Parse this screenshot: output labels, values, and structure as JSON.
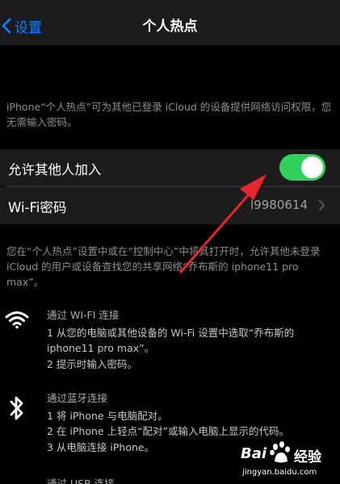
{
  "nav": {
    "back_label": "设置",
    "title": "个人热点"
  },
  "description_top": "iPhone“个人热点”可为其他已登录 iCloud 的设备提供网络访问权限，您无需输入密码。",
  "settings": {
    "allow_others_label": "允许其他人加入",
    "allow_others_on": true,
    "wifi_password_label": "Wi-Fi密码",
    "wifi_password_value": "l9980614"
  },
  "description_mid": "您在“个人热点”设置中或在“控制中心”中将其打开时，允许其他未登录 iCloud 的用户或设备查找您的共享网络“乔布斯的 iphone11 pro max”。",
  "instructions": {
    "wifi": {
      "title": "通过 WI-FI 连接",
      "step1": "1 从您的电脑或其他设备的 Wi-Fi 设置中选取“乔布斯的 iphone11 pro max”。",
      "step2": "2 提示时输入密码。"
    },
    "bluetooth": {
      "title": "通过蓝牙连接",
      "step1": "1 将 iPhone 与电脑配对。",
      "step2": "2 在 iPhone 上轻点“配对”或输入电脑上显示的代码。",
      "step3": "3 从电脑连接 iPhone。"
    },
    "usb": {
      "title": "通过 USB 连接"
    }
  },
  "watermark": {
    "brand": "Bai",
    "brand2": "经验",
    "url": "jingyan.baidu.com"
  },
  "colors": {
    "accent": "#0a84ff",
    "toggle_on": "#30d158",
    "annotation_arrow": "#e5262b"
  }
}
